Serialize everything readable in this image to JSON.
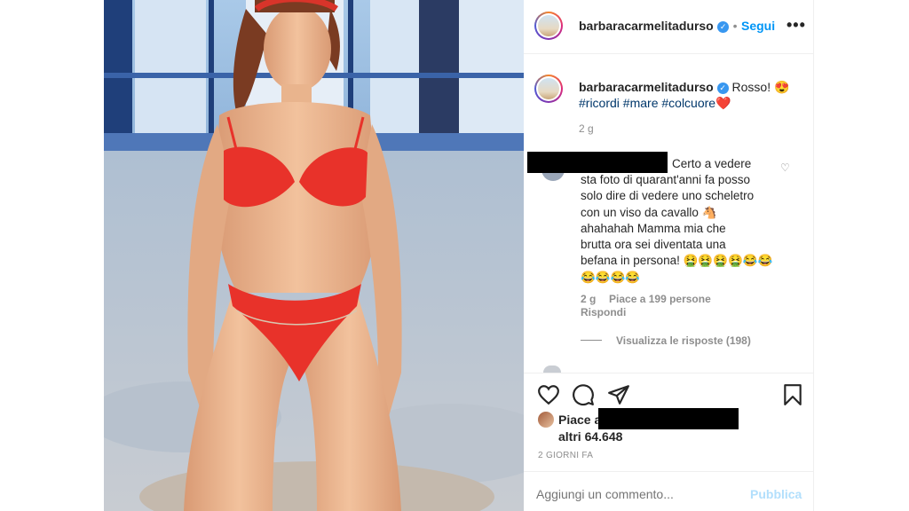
{
  "header": {
    "username": "barbaracarmelitadurso",
    "follow_label": "Segui",
    "more_icon": "ellipsis-icon"
  },
  "caption": {
    "username": "barbaracarmelitadurso",
    "text": "Rosso! 😍",
    "hashtags": "#ricordi #mare #colcuore❤️",
    "time": "2 g"
  },
  "comment": {
    "text_line1": "Certo a vedere",
    "text_line2": "sta foto di quarant'anni fa posso",
    "text_line3": "solo dire di vedere uno scheletro",
    "text_line4": "con un viso da cavallo 🐴",
    "text_line5": "ahahahah Mamma mia che",
    "text_line6": "brutta ora sei diventata una",
    "text_line7": "befana in persona! 🤮🤮🤮🤮😂😂",
    "text_line8": "😂😂😂😂",
    "time": "2 g",
    "likes": "Piace a 199 persone",
    "reply": "Rispondi",
    "view_replies": "Visualizza le risposte (198)"
  },
  "actions": {
    "like_icon": "heart-icon",
    "comment_icon": "comment-icon",
    "share_icon": "send-icon",
    "save_icon": "bookmark-icon"
  },
  "likes": {
    "prefix": "Piace a",
    "others": "altri 64.648"
  },
  "post_date": "2 GIORNI FA",
  "add_comment": {
    "placeholder": "Aggiungi un commento...",
    "publish_label": "Pubblica"
  },
  "colors": {
    "accent": "#0095f6",
    "bikini": "#e8322a",
    "sky": "#7aa9d6",
    "sand": "#c9cfd8"
  }
}
